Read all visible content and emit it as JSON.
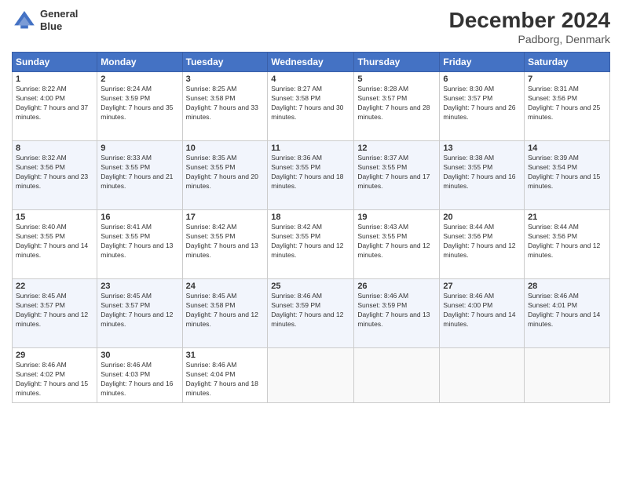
{
  "logo": {
    "line1": "General",
    "line2": "Blue"
  },
  "title": "December 2024",
  "location": "Padborg, Denmark",
  "days_of_week": [
    "Sunday",
    "Monday",
    "Tuesday",
    "Wednesday",
    "Thursday",
    "Friday",
    "Saturday"
  ],
  "weeks": [
    [
      {
        "num": "1",
        "sunrise": "Sunrise: 8:22 AM",
        "sunset": "Sunset: 4:00 PM",
        "daylight": "Daylight: 7 hours and 37 minutes."
      },
      {
        "num": "2",
        "sunrise": "Sunrise: 8:24 AM",
        "sunset": "Sunset: 3:59 PM",
        "daylight": "Daylight: 7 hours and 35 minutes."
      },
      {
        "num": "3",
        "sunrise": "Sunrise: 8:25 AM",
        "sunset": "Sunset: 3:58 PM",
        "daylight": "Daylight: 7 hours and 33 minutes."
      },
      {
        "num": "4",
        "sunrise": "Sunrise: 8:27 AM",
        "sunset": "Sunset: 3:58 PM",
        "daylight": "Daylight: 7 hours and 30 minutes."
      },
      {
        "num": "5",
        "sunrise": "Sunrise: 8:28 AM",
        "sunset": "Sunset: 3:57 PM",
        "daylight": "Daylight: 7 hours and 28 minutes."
      },
      {
        "num": "6",
        "sunrise": "Sunrise: 8:30 AM",
        "sunset": "Sunset: 3:57 PM",
        "daylight": "Daylight: 7 hours and 26 minutes."
      },
      {
        "num": "7",
        "sunrise": "Sunrise: 8:31 AM",
        "sunset": "Sunset: 3:56 PM",
        "daylight": "Daylight: 7 hours and 25 minutes."
      }
    ],
    [
      {
        "num": "8",
        "sunrise": "Sunrise: 8:32 AM",
        "sunset": "Sunset: 3:56 PM",
        "daylight": "Daylight: 7 hours and 23 minutes."
      },
      {
        "num": "9",
        "sunrise": "Sunrise: 8:33 AM",
        "sunset": "Sunset: 3:55 PM",
        "daylight": "Daylight: 7 hours and 21 minutes."
      },
      {
        "num": "10",
        "sunrise": "Sunrise: 8:35 AM",
        "sunset": "Sunset: 3:55 PM",
        "daylight": "Daylight: 7 hours and 20 minutes."
      },
      {
        "num": "11",
        "sunrise": "Sunrise: 8:36 AM",
        "sunset": "Sunset: 3:55 PM",
        "daylight": "Daylight: 7 hours and 18 minutes."
      },
      {
        "num": "12",
        "sunrise": "Sunrise: 8:37 AM",
        "sunset": "Sunset: 3:55 PM",
        "daylight": "Daylight: 7 hours and 17 minutes."
      },
      {
        "num": "13",
        "sunrise": "Sunrise: 8:38 AM",
        "sunset": "Sunset: 3:55 PM",
        "daylight": "Daylight: 7 hours and 16 minutes."
      },
      {
        "num": "14",
        "sunrise": "Sunrise: 8:39 AM",
        "sunset": "Sunset: 3:54 PM",
        "daylight": "Daylight: 7 hours and 15 minutes."
      }
    ],
    [
      {
        "num": "15",
        "sunrise": "Sunrise: 8:40 AM",
        "sunset": "Sunset: 3:55 PM",
        "daylight": "Daylight: 7 hours and 14 minutes."
      },
      {
        "num": "16",
        "sunrise": "Sunrise: 8:41 AM",
        "sunset": "Sunset: 3:55 PM",
        "daylight": "Daylight: 7 hours and 13 minutes."
      },
      {
        "num": "17",
        "sunrise": "Sunrise: 8:42 AM",
        "sunset": "Sunset: 3:55 PM",
        "daylight": "Daylight: 7 hours and 13 minutes."
      },
      {
        "num": "18",
        "sunrise": "Sunrise: 8:42 AM",
        "sunset": "Sunset: 3:55 PM",
        "daylight": "Daylight: 7 hours and 12 minutes."
      },
      {
        "num": "19",
        "sunrise": "Sunrise: 8:43 AM",
        "sunset": "Sunset: 3:55 PM",
        "daylight": "Daylight: 7 hours and 12 minutes."
      },
      {
        "num": "20",
        "sunrise": "Sunrise: 8:44 AM",
        "sunset": "Sunset: 3:56 PM",
        "daylight": "Daylight: 7 hours and 12 minutes."
      },
      {
        "num": "21",
        "sunrise": "Sunrise: 8:44 AM",
        "sunset": "Sunset: 3:56 PM",
        "daylight": "Daylight: 7 hours and 12 minutes."
      }
    ],
    [
      {
        "num": "22",
        "sunrise": "Sunrise: 8:45 AM",
        "sunset": "Sunset: 3:57 PM",
        "daylight": "Daylight: 7 hours and 12 minutes."
      },
      {
        "num": "23",
        "sunrise": "Sunrise: 8:45 AM",
        "sunset": "Sunset: 3:57 PM",
        "daylight": "Daylight: 7 hours and 12 minutes."
      },
      {
        "num": "24",
        "sunrise": "Sunrise: 8:45 AM",
        "sunset": "Sunset: 3:58 PM",
        "daylight": "Daylight: 7 hours and 12 minutes."
      },
      {
        "num": "25",
        "sunrise": "Sunrise: 8:46 AM",
        "sunset": "Sunset: 3:59 PM",
        "daylight": "Daylight: 7 hours and 12 minutes."
      },
      {
        "num": "26",
        "sunrise": "Sunrise: 8:46 AM",
        "sunset": "Sunset: 3:59 PM",
        "daylight": "Daylight: 7 hours and 13 minutes."
      },
      {
        "num": "27",
        "sunrise": "Sunrise: 8:46 AM",
        "sunset": "Sunset: 4:00 PM",
        "daylight": "Daylight: 7 hours and 14 minutes."
      },
      {
        "num": "28",
        "sunrise": "Sunrise: 8:46 AM",
        "sunset": "Sunset: 4:01 PM",
        "daylight": "Daylight: 7 hours and 14 minutes."
      }
    ],
    [
      {
        "num": "29",
        "sunrise": "Sunrise: 8:46 AM",
        "sunset": "Sunset: 4:02 PM",
        "daylight": "Daylight: 7 hours and 15 minutes."
      },
      {
        "num": "30",
        "sunrise": "Sunrise: 8:46 AM",
        "sunset": "Sunset: 4:03 PM",
        "daylight": "Daylight: 7 hours and 16 minutes."
      },
      {
        "num": "31",
        "sunrise": "Sunrise: 8:46 AM",
        "sunset": "Sunset: 4:04 PM",
        "daylight": "Daylight: 7 hours and 18 minutes."
      },
      null,
      null,
      null,
      null
    ]
  ]
}
